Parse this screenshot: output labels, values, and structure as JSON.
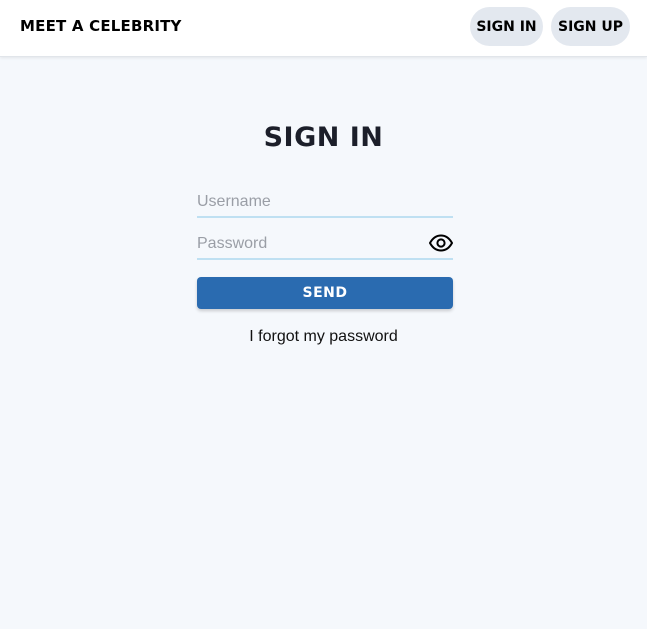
{
  "header": {
    "brand": "MEET A CELEBRITY",
    "nav": {
      "sign_in": "SIGN IN",
      "sign_up": "SIGN UP"
    }
  },
  "login": {
    "title": "SIGN IN",
    "username": {
      "placeholder": "Username",
      "value": ""
    },
    "password": {
      "placeholder": "Password",
      "value": "",
      "toggle_icon": "eye-icon"
    },
    "send_label": "SEND",
    "forgot_label": "I forgot my password"
  },
  "colors": {
    "background": "#f5f8fc",
    "header_bg": "#ffffff",
    "nav_button_bg": "#e3e8ef",
    "accent": "#2a6bb0",
    "field_underline": "#bfe0f2",
    "title": "#1c1f2a"
  }
}
